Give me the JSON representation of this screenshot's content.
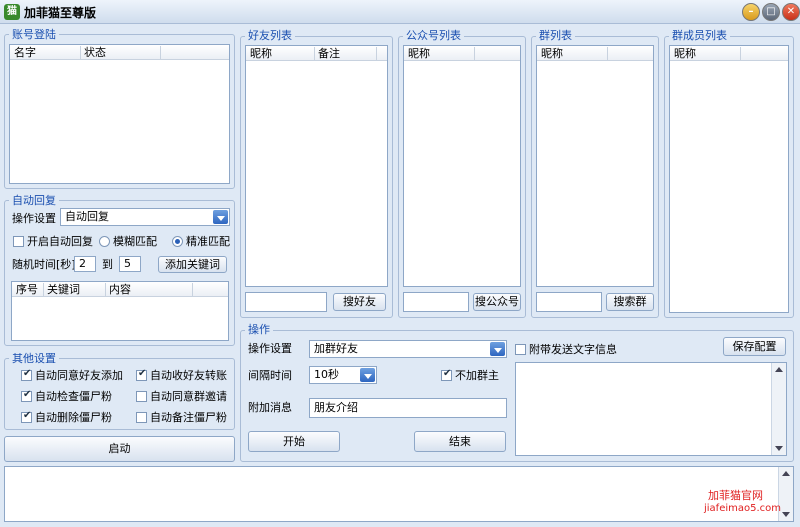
{
  "window": {
    "title": "加菲猫至尊版",
    "app_icon_glyph": "猫"
  },
  "account_login": {
    "legend": "账号登陆",
    "columns": [
      "名字",
      "状态"
    ]
  },
  "auto_reply": {
    "legend": "自动回复",
    "op_label": "操作设置",
    "op_value": "自动回复",
    "enable_label": "开启自动回复",
    "fuzzy_label": "模糊匹配",
    "exact_label": "精准匹配",
    "random_time_label": "随机时间[秒]",
    "from_value": "2",
    "to_label": "到",
    "to_value": "5",
    "add_keyword_button": "添加关键词",
    "columns": [
      "序号",
      "关键词",
      "内容"
    ]
  },
  "other_settings": {
    "legend": "其他设置",
    "items": [
      {
        "label": "自动同意好友添加",
        "checked": true
      },
      {
        "label": "自动收好友转账",
        "checked": true
      },
      {
        "label": "自动检查僵尸粉",
        "checked": true
      },
      {
        "label": "自动同意群邀请",
        "checked": false
      },
      {
        "label": "自动删除僵尸粉",
        "checked": true
      },
      {
        "label": "自动备注僵尸粉",
        "checked": false
      }
    ]
  },
  "start_button": "启动",
  "friends": {
    "legend": "好友列表",
    "columns": [
      "昵称",
      "备注"
    ],
    "search_button": "搜好友"
  },
  "official": {
    "legend": "公众号列表",
    "columns": [
      "昵称"
    ],
    "search_button": "搜公众号"
  },
  "groups": {
    "legend": "群列表",
    "columns": [
      "昵称"
    ],
    "search_button": "搜索群"
  },
  "members": {
    "legend": "群成员列表",
    "columns": [
      "昵称"
    ]
  },
  "operation": {
    "legend": "操作",
    "op_label": "操作设置",
    "op_value": "加群好友",
    "attach_text_label": "附带发送文字信息",
    "save_button": "保存配置",
    "interval_label": "间隔时间",
    "interval_value": "10秒",
    "no_owner_label": "不加群主",
    "extra_msg_label": "附加消息",
    "extra_msg_value": "朋友介绍",
    "start_button": "开始",
    "end_button": "结束"
  },
  "watermark": {
    "line1": "加菲猫官网",
    "line2": "jiafeimao5.com"
  },
  "colors": {
    "accent": "#1a4fb0",
    "watermark": "#e02020",
    "background": "#dfe9f5"
  }
}
